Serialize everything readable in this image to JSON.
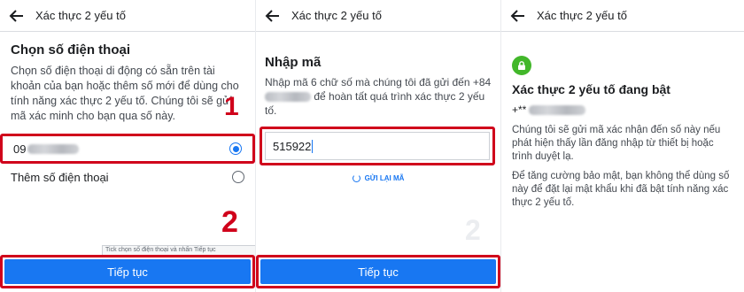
{
  "header": {
    "title": "Xác thực 2 yếu tố"
  },
  "step1": {
    "title": "Chọn số điện thoại",
    "description": "Chọn số điện thoại di động có sẵn trên tài khoản của bạn hoặc thêm số mới để dùng cho tính năng xác thực 2 yếu tố. Chúng tôi sẽ gửi mã xác minh cho bạn qua số này.",
    "marker_1": "1",
    "marker_2": "2",
    "phone_prefix": "09",
    "add_phone_label": "Thêm số điện thoại",
    "tooltip": "Tick chọn số điện thoại và nhấn Tiếp tục",
    "continue_label": "Tiếp tục"
  },
  "step2": {
    "title": "Nhập mã",
    "description_start": "Nhập mã 6 chữ số mà chúng tôi đã gửi đến +84",
    "description_end": "để hoàn tất quá trình xác thực 2 yếu tố.",
    "code_value": "515922",
    "resend_label": "GỬI LẠI MÃ",
    "watermark": "2",
    "continue_label": "Tiếp tục"
  },
  "step3": {
    "title": "Xác thực 2 yếu tố đang bật",
    "phone_prefix": "+**",
    "text1": "Chúng tôi sẽ gửi mã xác nhận đến số này nếu phát hiện thấy lần đăng nhập từ thiết bị hoặc trình duyệt lạ.",
    "text2": "Để tăng cường bảo mật, bạn không thể dùng số này để đặt lại mật khẩu khi đã bật tính năng xác thực 2 yếu tố."
  },
  "colors": {
    "accent": "#1877f2",
    "highlight": "#d0021b",
    "success": "#42b72a"
  }
}
